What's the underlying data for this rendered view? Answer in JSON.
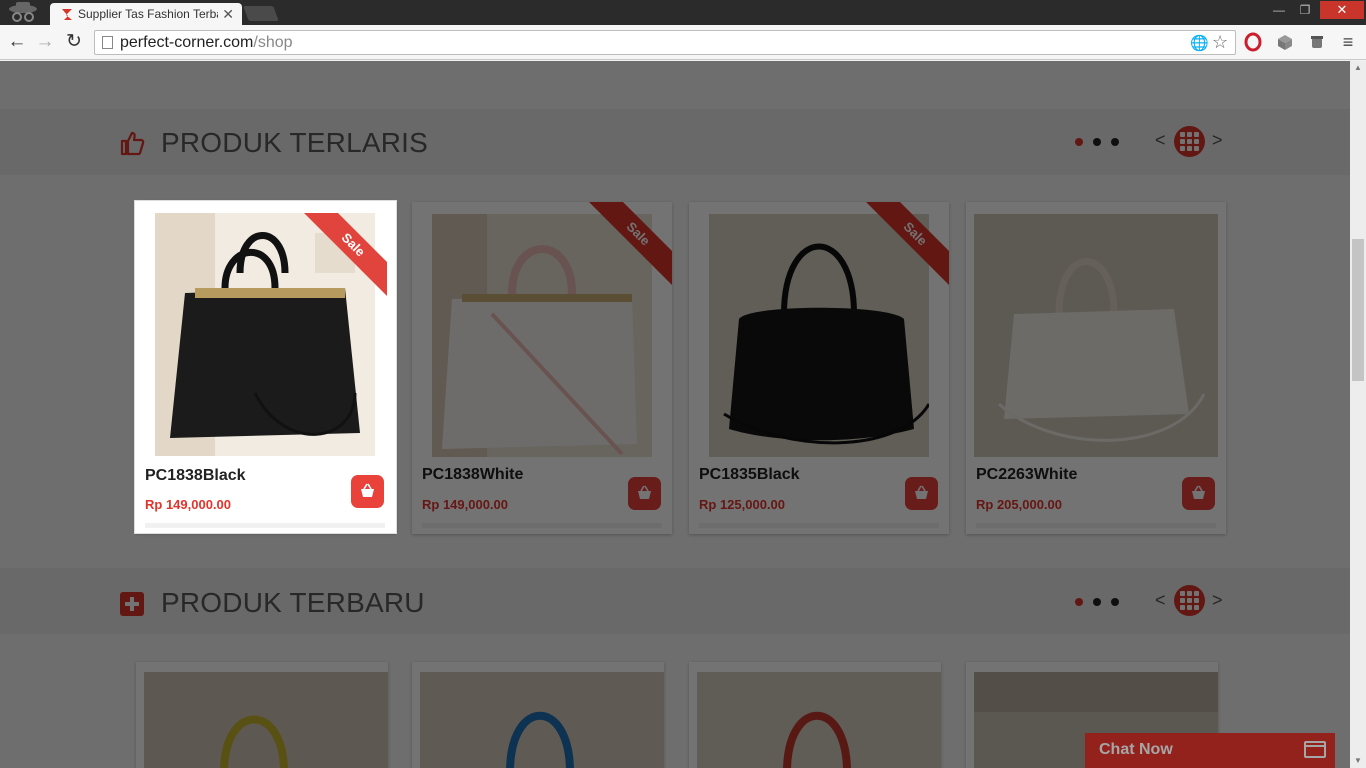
{
  "browser": {
    "tab_title": "Supplier Tas Fashion Terbaru",
    "tab_close": "✕",
    "url_host": "perfect-corner.com",
    "url_path": "/shop",
    "window_min": "—",
    "window_max": "❐",
    "window_close": "✕"
  },
  "icons": {
    "back": "←",
    "forward": "→",
    "reload": "↻",
    "translate": "🌐",
    "star": "☆",
    "menu": "≡",
    "prev": "<",
    "next": ">"
  },
  "sections": [
    {
      "title": "PRODUK TERLARIS",
      "products": [
        {
          "name": "PC1838Black",
          "price": "Rp 149,000.00",
          "badge": "Sale"
        },
        {
          "name": "PC1838White",
          "price": "Rp 149,000.00",
          "badge": "Sale"
        },
        {
          "name": "PC1835Black",
          "price": "Rp 125,000.00",
          "badge": "Sale"
        },
        {
          "name": "PC2263White",
          "price": "Rp 205,000.00",
          "badge": ""
        }
      ]
    },
    {
      "title": "PRODUK TERBARU"
    }
  ],
  "chat": {
    "label": "Chat Now"
  },
  "colors": {
    "accent": "#d9342b",
    "price": "#e2342b",
    "overlay": "rgba(0,0,0,0.55)"
  }
}
